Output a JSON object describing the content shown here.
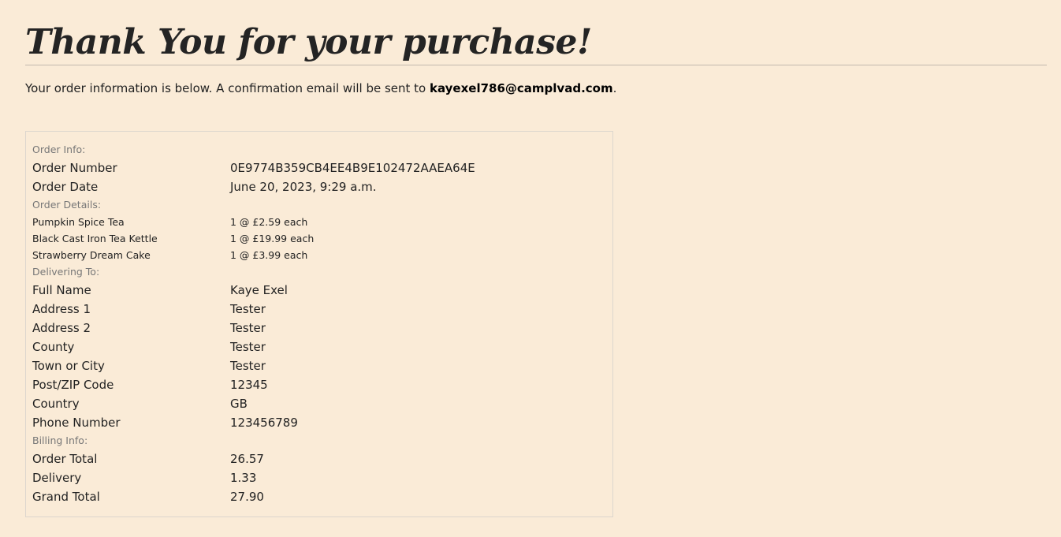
{
  "page": {
    "title": "Thank You for your purchase!",
    "intro_text": "Your order information is below. A confirmation email will be sent to ",
    "email": "kayexel786@camplvad.com",
    "intro_end": "."
  },
  "order_info": {
    "label": "Order Info:",
    "rows": [
      {
        "key": "Order Number",
        "value": "0E9774B359CB4EE4B9E102472AAEA64E"
      },
      {
        "key": "Order Date",
        "value": "June 20, 2023, 9:29 a.m."
      }
    ]
  },
  "order_details": {
    "label": "Order Details:",
    "items": [
      {
        "name": "Pumpkin Spice Tea",
        "qty_price": "1 @ £2.59 each"
      },
      {
        "name": "Black Cast Iron Tea Kettle",
        "qty_price": "1 @ £19.99 each"
      },
      {
        "name": "Strawberry Dream Cake",
        "qty_price": "1 @ £3.99 each"
      }
    ]
  },
  "delivering_to": {
    "label": "Delivering To:",
    "rows": [
      {
        "key": "Full Name",
        "value": "Kaye Exel"
      },
      {
        "key": "Address 1",
        "value": "Tester"
      },
      {
        "key": "Address 2",
        "value": "Tester"
      },
      {
        "key": "County",
        "value": "Tester"
      },
      {
        "key": "Town or City",
        "value": "Tester"
      },
      {
        "key": "Post/ZIP Code",
        "value": "12345"
      },
      {
        "key": "Country",
        "value": "GB"
      },
      {
        "key": "Phone Number",
        "value": "123456789"
      }
    ]
  },
  "billing_info": {
    "label": "Billing Info:",
    "rows": [
      {
        "key": "Order Total",
        "value": "26.57"
      },
      {
        "key": "Delivery",
        "value": "1.33"
      },
      {
        "key": "Grand Total",
        "value": "27.90"
      }
    ]
  }
}
